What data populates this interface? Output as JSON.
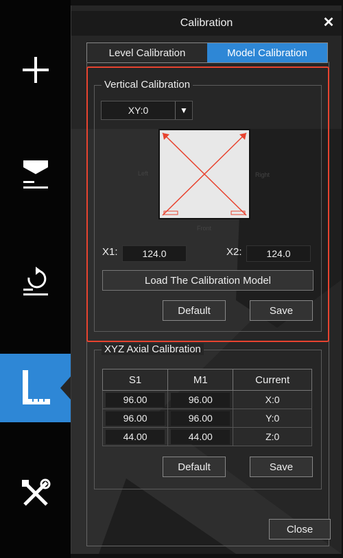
{
  "window": {
    "title": "Calibration"
  },
  "tabs": [
    {
      "label": "Level Calibration",
      "active": false
    },
    {
      "label": "Model Calibration",
      "active": true
    }
  ],
  "sidebar": {
    "items": [
      {
        "icon": "plus-icon"
      },
      {
        "icon": "level-bed-icon"
      },
      {
        "icon": "rotate-icon"
      },
      {
        "icon": "ruler-calibration-icon",
        "active": true
      },
      {
        "icon": "tools-icon"
      }
    ]
  },
  "vertical_calibration": {
    "title": "Vertical Calibration",
    "axis_select": {
      "value": "XY:0"
    },
    "diagram": {
      "left_label": "Left",
      "right_label": "Right",
      "front_label": "Front"
    },
    "x1_label": "X1:",
    "x1_value": "124.0",
    "x2_label": "X2:",
    "x2_value": "124.0",
    "load_button": "Load The Calibration Model",
    "default_button": "Default",
    "save_button": "Save"
  },
  "xyz_calibration": {
    "title": "XYZ Axial Calibration",
    "columns": [
      "S1",
      "M1",
      "Current"
    ],
    "rows": [
      {
        "s1": "96.00",
        "m1": "96.00",
        "current": "X:0"
      },
      {
        "s1": "96.00",
        "m1": "96.00",
        "current": "Y:0"
      },
      {
        "s1": "44.00",
        "m1": "44.00",
        "current": "Z:0"
      }
    ],
    "default_button": "Default",
    "save_button": "Save"
  },
  "close_button": "Close",
  "colors": {
    "accent": "#2e87d6",
    "highlight": "#e8432f"
  }
}
